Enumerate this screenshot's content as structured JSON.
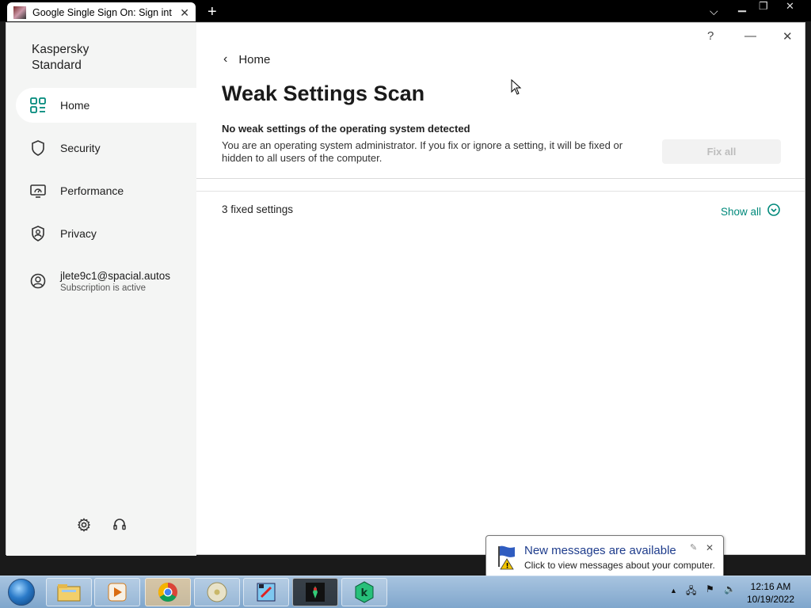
{
  "browser": {
    "tab_title": "Google Single Sign On: Sign into",
    "new_tab_icon": "plus-icon",
    "tab_menu_icon": "chevron-down-icon"
  },
  "app": {
    "brand_line1": "Kaspersky",
    "brand_line2": "Standard",
    "nav": [
      {
        "label": "Home",
        "icon": "home-grid-icon",
        "active": true
      },
      {
        "label": "Security",
        "icon": "shield-icon",
        "active": false
      },
      {
        "label": "Performance",
        "icon": "monitor-gauge-icon",
        "active": false
      },
      {
        "label": "Privacy",
        "icon": "privacy-shield-icon",
        "active": false
      }
    ],
    "account": {
      "email": "jlete9c1@spacial.autos",
      "subscription": "Subscription is active"
    },
    "window_controls": {
      "help": "?",
      "minimize": "—",
      "close": "✕"
    }
  },
  "main": {
    "back_label": "Home",
    "title": "Weak Settings Scan",
    "status": "No weak settings of the operating system detected",
    "description": "You are an operating system administrator. If you fix or ignore a setting, it will be fixed or hidden to all users of the computer.",
    "fix_all_label": "Fix all",
    "fixed_settings": "3 fixed settings",
    "show_all_label": "Show all"
  },
  "notification": {
    "title": "New messages are available",
    "text": "Click to view messages about your computer."
  },
  "taskbar": {
    "time": "12:16 AM",
    "date": "10/19/2022",
    "pinned": [
      "file-explorer-icon",
      "media-player-icon",
      "chrome-icon",
      "disc-icon",
      "paint-icon",
      "game-icon",
      "kaspersky-icon"
    ]
  },
  "colors": {
    "accent": "#00897b",
    "sidebar_bg": "#f4f5f4",
    "taskbar": "#8fb2d6"
  }
}
